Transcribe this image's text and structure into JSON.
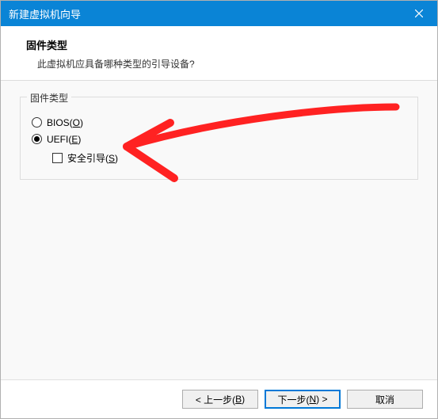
{
  "window": {
    "title": "新建虚拟机向导"
  },
  "header": {
    "heading": "固件类型",
    "subtext": "此虚拟机应具备哪种类型的引导设备?"
  },
  "group": {
    "legend": "固件类型",
    "options": {
      "bios": {
        "prefix": "BIOS(",
        "hotkey": "O",
        "suffix": ")",
        "checked": false
      },
      "uefi": {
        "prefix": "UEFI(",
        "hotkey": "E",
        "suffix": ")",
        "checked": true
      },
      "secure": {
        "prefix": "安全引导(",
        "hotkey": "S",
        "suffix": ")",
        "checked": false
      }
    }
  },
  "footer": {
    "back": {
      "lead": "< 上一步(",
      "hotkey": "B",
      "tail": ")"
    },
    "next": {
      "lead": "下一步(",
      "hotkey": "N",
      "tail": ") >"
    },
    "cancel": "取消"
  }
}
